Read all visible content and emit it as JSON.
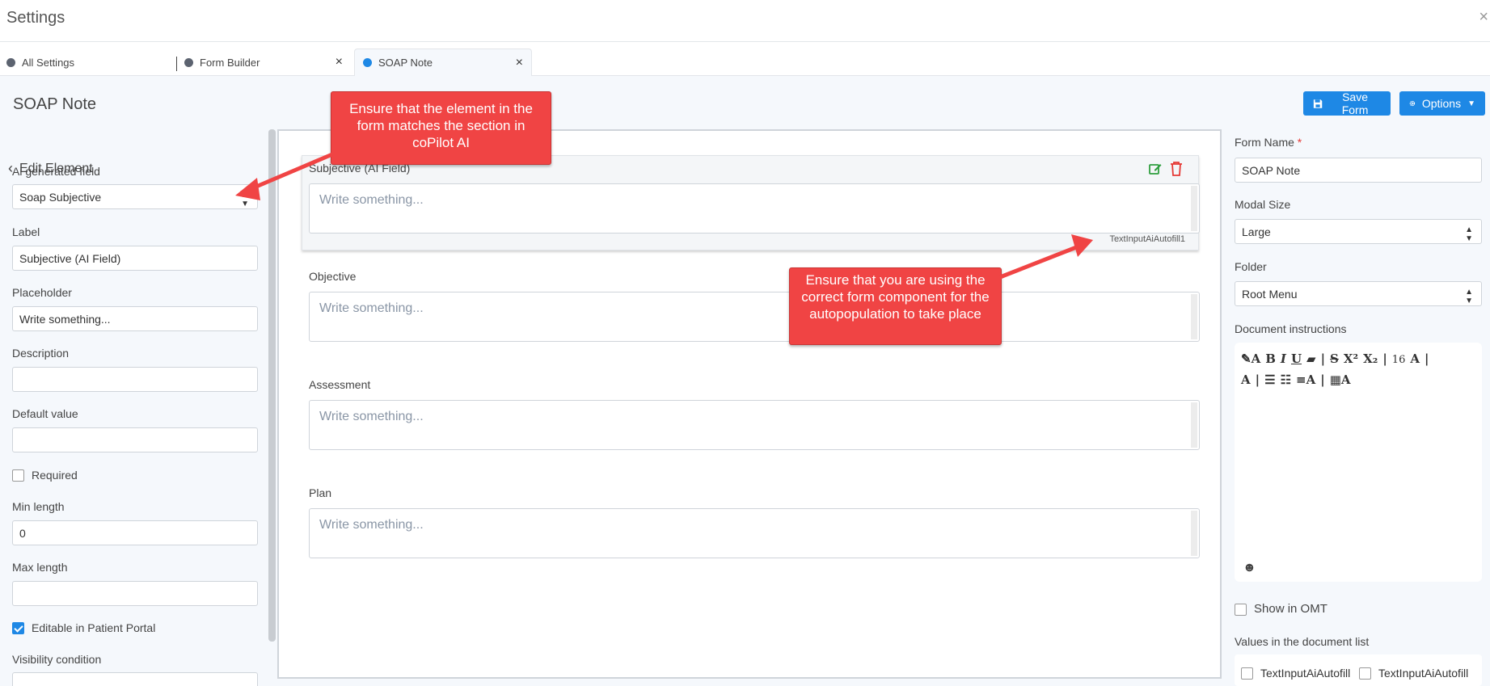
{
  "window": {
    "title": "Settings",
    "close_glyph": "×"
  },
  "tabs": [
    {
      "label": "All Settings"
    },
    {
      "label": "Form Builder",
      "close": "×"
    },
    {
      "label": "SOAP Note",
      "close": "×"
    }
  ],
  "page": {
    "title": "SOAP Note"
  },
  "toolbar": {
    "save_label": "Save Form",
    "options_label": "Options"
  },
  "left_panel": {
    "back_label": "Edit Element",
    "ai_field": {
      "label": "Ai generated field",
      "value": "Soap Subjective"
    },
    "label_field": {
      "label": "Label",
      "value": "Subjective (AI Field)"
    },
    "placeholder_field": {
      "label": "Placeholder",
      "value": "Write something..."
    },
    "description_field": {
      "label": "Description",
      "value": ""
    },
    "default_field": {
      "label": "Default value",
      "value": ""
    },
    "required": {
      "label": "Required",
      "checked": false
    },
    "min_length": {
      "label": "Min length",
      "value": "0"
    },
    "max_length": {
      "label": "Max length",
      "value": ""
    },
    "editable_portal": {
      "label": "Editable in Patient Portal",
      "checked": true
    },
    "visibility": {
      "label": "Visibility condition"
    }
  },
  "form_canvas": {
    "fields": [
      {
        "label": "Subjective (AI Field)",
        "placeholder": "Write something...",
        "component": "TextInputAiAutofill1"
      },
      {
        "label": "Objective",
        "placeholder": "Write something..."
      },
      {
        "label": "Assessment",
        "placeholder": "Write something..."
      },
      {
        "label": "Plan",
        "placeholder": "Write something..."
      }
    ]
  },
  "right_panel": {
    "form_name": {
      "label": "Form Name",
      "required_mark": "*",
      "value": "SOAP Note"
    },
    "modal_size": {
      "label": "Modal Size",
      "value": "Large"
    },
    "folder": {
      "label": "Folder",
      "value": "Root Menu"
    },
    "doc_instructions": {
      "label": "Document instructions",
      "font_size": "16"
    },
    "show_omt": {
      "label": "Show in OMT"
    },
    "values_list": {
      "label": "Values in the document list",
      "option_a": "TextInputAiAutofill",
      "option_b": "TextInputAiAutofill"
    }
  },
  "annotations": {
    "callout_1": "Ensure that the element in the form matches the section in coPilot AI",
    "callout_2": "Ensure that you are using the correct form component for the autopopulation to take place"
  },
  "colors": {
    "accent": "#1e88e5",
    "callout": "#f04444",
    "edit_icon": "#2e9e3e",
    "delete_icon": "#e53935"
  }
}
